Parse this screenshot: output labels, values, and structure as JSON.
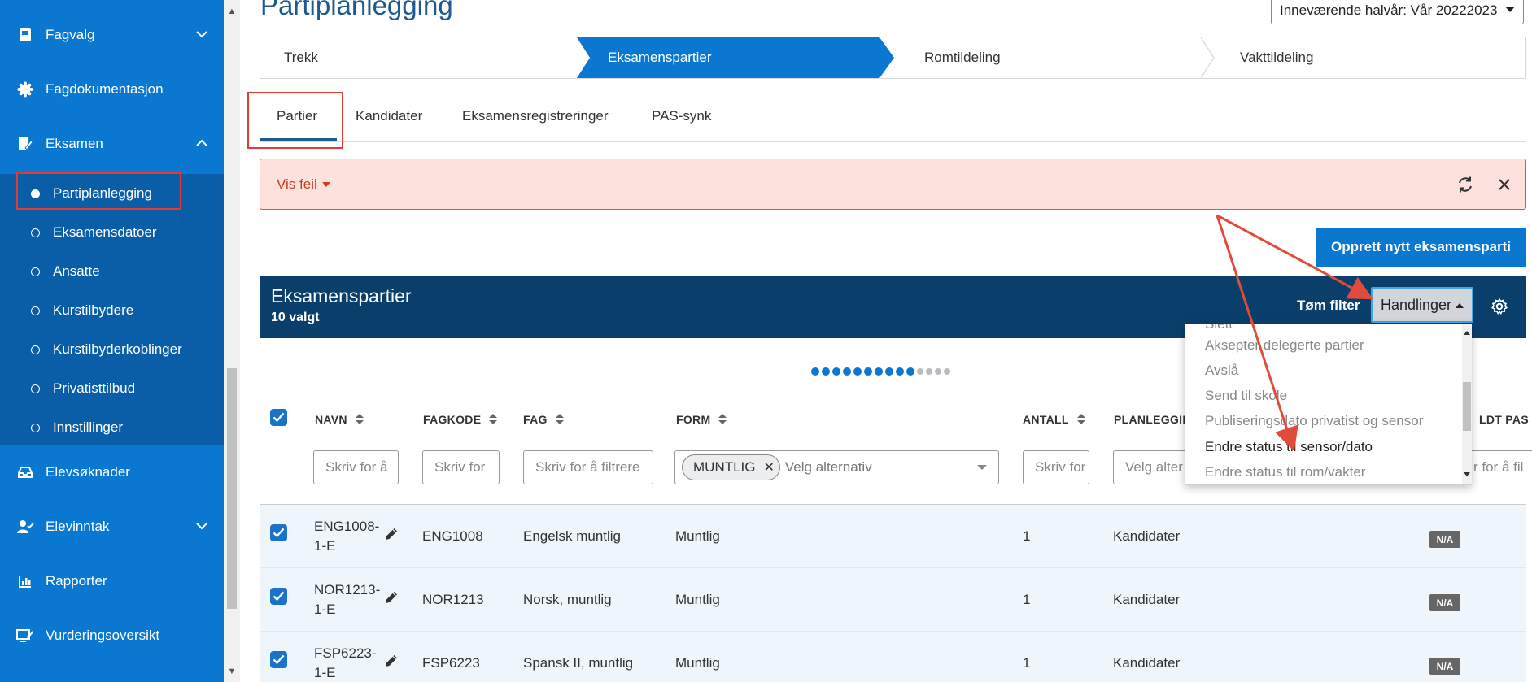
{
  "sidebar": {
    "items": [
      {
        "label": "Fagvalg"
      },
      {
        "label": "Fagdokumentasjon"
      },
      {
        "label": "Eksamen"
      },
      {
        "label": "Elevsøknader"
      },
      {
        "label": "Elevinntak"
      },
      {
        "label": "Rapporter"
      },
      {
        "label": "Vurderingsoversikt"
      }
    ],
    "eksamen_sub": [
      {
        "label": "Partiplanlegging"
      },
      {
        "label": "Eksamensdatoer"
      },
      {
        "label": "Ansatte"
      },
      {
        "label": "Kurstilbydere"
      },
      {
        "label": "Kurstilbyderkoblinger"
      },
      {
        "label": "Privatisttilbud"
      },
      {
        "label": "Innstillinger"
      }
    ]
  },
  "header": {
    "title": "Partiplanlegging",
    "semester": "Inneværende halvår: Vår 20222023"
  },
  "steps": [
    {
      "label": "Trekk"
    },
    {
      "label": "Eksamenspartier"
    },
    {
      "label": "Romtildeling"
    },
    {
      "label": "Vakttildeling"
    }
  ],
  "tabs": [
    {
      "label": "Partier"
    },
    {
      "label": "Kandidater"
    },
    {
      "label": "Eksamensregistreringer"
    },
    {
      "label": "PAS-synk"
    }
  ],
  "error": {
    "label": "Vis feil"
  },
  "create_button": "Opprett nytt eksamensparti",
  "table": {
    "title": "Eksamenspartier",
    "selected": "10 valgt",
    "clear_filter": "Tøm filter",
    "actions": "Handlinger",
    "columns": [
      "NAVN",
      "FAGKODE",
      "FAG",
      "FORM",
      "ANTALL",
      "PLANLEGGIN",
      "LDT PAS"
    ],
    "filters": {
      "navn": "Skriv for å",
      "fagkode": "Skriv for",
      "fag": "Skriv for å filtrere",
      "form_chip": "MUNTLIG",
      "form": "Velg alternativ",
      "antall": "Skriv for",
      "planlegging": "Velg alter",
      "pas": "r for å fil"
    },
    "rows": [
      {
        "navn": "ENG1008-1-E",
        "fagkode": "ENG1008",
        "fag": "Engelsk muntlig",
        "form": "Muntlig",
        "antall": "1",
        "planlegging": "Kandidater",
        "pas": "N/A"
      },
      {
        "navn": "NOR1213-1-E",
        "fagkode": "NOR1213",
        "fag": "Norsk, muntlig",
        "form": "Muntlig",
        "antall": "1",
        "planlegging": "Kandidater",
        "pas": "N/A"
      },
      {
        "navn": "FSP6223-1-E",
        "fagkode": "FSP6223",
        "fag": "Spansk II, muntlig",
        "form": "Muntlig",
        "antall": "1",
        "planlegging": "Kandidater",
        "pas": "N/A"
      }
    ]
  },
  "dropdown": {
    "items": [
      {
        "label": "Slett"
      },
      {
        "label": "Aksepter delegerte partier"
      },
      {
        "label": "Avslå"
      },
      {
        "label": "Send til skole"
      },
      {
        "label": "Publiseringsdato privatist og sensor"
      },
      {
        "label": "Endre status til sensor/dato"
      },
      {
        "label": "Endre status til rom/vakter"
      }
    ]
  },
  "pager": {
    "total": 14,
    "active": 10
  },
  "colors": {
    "sidebar": "#0a78d1",
    "sidebar_sub": "#0a5ea8",
    "header_bar": "#0b3f6b",
    "highlight": "#e53935",
    "error_bg": "#fde1dc"
  }
}
